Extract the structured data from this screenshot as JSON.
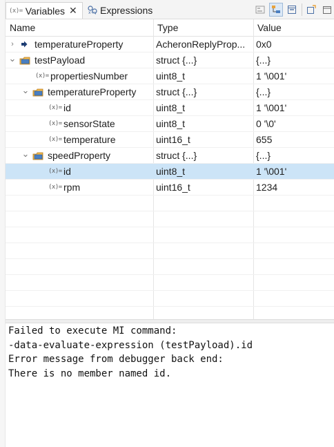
{
  "tabs": {
    "variables": {
      "label": "Variables",
      "icon": "variable-icon",
      "close": "✕"
    },
    "expressions": {
      "label": "Expressions",
      "icon": "expressions-icon"
    }
  },
  "toolbar": {
    "buttons": [
      "show-type-names-icon",
      "show-logical-structure-icon",
      "collapse-all-icon",
      "new-view-icon",
      "view-menu-icon"
    ]
  },
  "columns": {
    "name": "Name",
    "type": "Type",
    "value": "Value"
  },
  "rows": [
    {
      "name": "temperatureProperty",
      "type": "AcheronReplyProp...",
      "value": "0x0",
      "indent": 0,
      "twisty": "›",
      "icon": "pointer-icon"
    },
    {
      "name": "testPayload",
      "type": "struct {...}",
      "value": "{...}",
      "indent": 0,
      "twisty": "⌄",
      "icon": "struct-icon"
    },
    {
      "name": "propertiesNumber",
      "type": "uint8_t",
      "value": "1 '\\001'",
      "indent": 1,
      "twisty": "",
      "icon": "variable-icon"
    },
    {
      "name": "temperatureProperty",
      "type": "struct {...}",
      "value": "{...}",
      "indent": 1,
      "twisty": "⌄",
      "icon": "struct-icon"
    },
    {
      "name": "id",
      "type": "uint8_t",
      "value": "1 '\\001'",
      "indent": 2,
      "twisty": "",
      "icon": "variable-icon"
    },
    {
      "name": "sensorState",
      "type": "uint8_t",
      "value": "0 '\\0'",
      "indent": 2,
      "twisty": "",
      "icon": "variable-icon"
    },
    {
      "name": "temperature",
      "type": "uint16_t",
      "value": "655",
      "indent": 2,
      "twisty": "",
      "icon": "variable-icon"
    },
    {
      "name": "speedProperty",
      "type": "struct {...}",
      "value": "{...}",
      "indent": 1,
      "twisty": "⌄",
      "icon": "struct-icon"
    },
    {
      "name": "id",
      "type": "uint8_t",
      "value": "1 '\\001'",
      "indent": 2,
      "twisty": "",
      "icon": "variable-icon",
      "selected": true
    },
    {
      "name": "rpm",
      "type": "uint16_t",
      "value": "1234",
      "indent": 2,
      "twisty": "",
      "icon": "variable-icon"
    }
  ],
  "empty_row_count": 8,
  "detail": {
    "lines": [
      "Failed to execute MI command:",
      "-data-evaluate-expression (testPayload).id",
      "Error message from debugger back end:",
      "There is no member named id."
    ]
  },
  "colors": {
    "selection": "#cce4f7",
    "struct_icon": "#e8a33d",
    "pointer_icon": "#1e3e74"
  }
}
